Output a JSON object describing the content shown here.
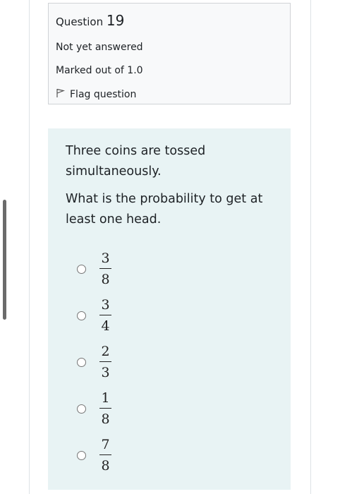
{
  "question_info": {
    "title_prefix": "Question",
    "number": "19",
    "state": "Not yet answered",
    "marks": "Marked out of 1.0",
    "flag_label": "Flag question"
  },
  "question": {
    "text_1": "Three coins are tossed simultaneously.",
    "text_2": "What is the probability to get at least one head."
  },
  "answers": [
    {
      "numerator": "3",
      "denominator": "8"
    },
    {
      "numerator": "3",
      "denominator": "4"
    },
    {
      "numerator": "2",
      "denominator": "3"
    },
    {
      "numerator": "1",
      "denominator": "8"
    },
    {
      "numerator": "7",
      "denominator": "8"
    }
  ],
  "colors": {
    "info_bg": "#f8f9fa",
    "content_bg": "#e8f3f4",
    "text": "#1d2125"
  }
}
